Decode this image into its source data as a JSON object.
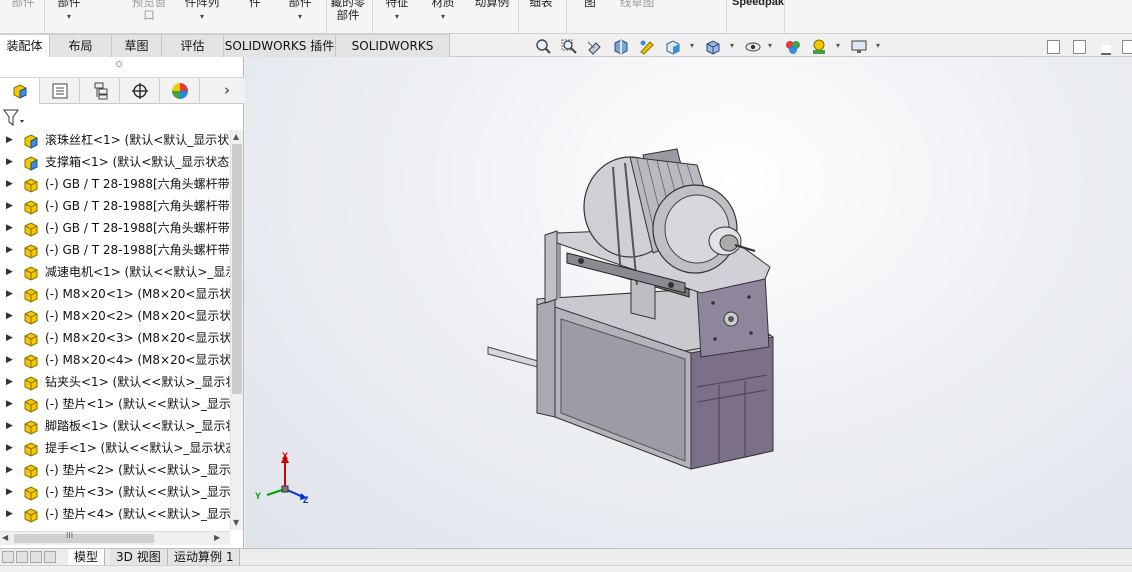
{
  "ribbon": {
    "items": [
      {
        "label": "部件",
        "dim": true
      },
      {
        "label": "部件",
        "caret": true
      },
      {
        "label": "预览窗口",
        "dim": true
      },
      {
        "label": "件阵列",
        "caret": true
      },
      {
        "label": "件"
      },
      {
        "label": "部件",
        "caret": true
      },
      {
        "label": "藏的零部件"
      },
      {
        "label": "特征",
        "caret": true
      },
      {
        "label": "材质",
        "caret": true
      },
      {
        "label": "动算例"
      },
      {
        "label": "细表"
      },
      {
        "label": "图"
      },
      {
        "label": "线草图",
        "dim": true
      },
      {
        "label": "Speedpak"
      }
    ]
  },
  "command_tabs": [
    {
      "label": "装配体",
      "active": true
    },
    {
      "label": "布局"
    },
    {
      "label": "草图"
    },
    {
      "label": "评估"
    },
    {
      "label": "SOLIDWORKS 插件"
    },
    {
      "label": "SOLIDWORKS MBD"
    }
  ],
  "heads_up_toolbar": [
    "zoom-to-fit-icon",
    "zoom-to-area-icon",
    "previous-view-icon",
    "section-view-icon",
    "dynamic-annotation-icon",
    "view-orientation-icon",
    "display-style-icon",
    "hide-show-icon",
    "edit-appearance-icon",
    "apply-scene-icon",
    "view-settings-icon"
  ],
  "panel_tabs": [
    "featuremanager-icon",
    "propertymanager-icon",
    "configurationmanager-icon",
    "dimxpertmanager-icon",
    "displaymanager-icon"
  ],
  "tree": {
    "items": [
      {
        "label": "滚珠丝杠<1> (默认<默认_显示状",
        "type": "assembly"
      },
      {
        "label": "支撑箱<1> (默认<默认_显示状态-",
        "type": "assembly"
      },
      {
        "label": "(-) GB / T 28-1988[六角头螺杆带",
        "type": "part"
      },
      {
        "label": "(-) GB / T 28-1988[六角头螺杆带",
        "type": "part"
      },
      {
        "label": "(-) GB / T 28-1988[六角头螺杆带",
        "type": "part"
      },
      {
        "label": "(-) GB / T 28-1988[六角头螺杆带",
        "type": "part"
      },
      {
        "label": "减速电机<1> (默认<<默认>_显示",
        "type": "part"
      },
      {
        "label": "(-) M8×20<1> (M8×20<显示状",
        "type": "part"
      },
      {
        "label": "(-) M8×20<2> (M8×20<显示状",
        "type": "part"
      },
      {
        "label": "(-) M8×20<3> (M8×20<显示状",
        "type": "part"
      },
      {
        "label": "(-) M8×20<4> (M8×20<显示状",
        "type": "part"
      },
      {
        "label": "钻夹头<1> (默认<<默认>_显示状",
        "type": "part"
      },
      {
        "label": "(-) 垫片<1> (默认<<默认>_显示状",
        "type": "part"
      },
      {
        "label": "脚踏板<1> (默认<<默认>_显示状",
        "type": "part"
      },
      {
        "label": "提手<1> (默认<<默认>_显示状态",
        "type": "part"
      },
      {
        "label": "(-) 垫片<2> (默认<<默认>_显示状",
        "type": "part"
      },
      {
        "label": "(-) 垫片<3> (默认<<默认>_显示状",
        "type": "part"
      },
      {
        "label": "(-) 垫片<4> (默认<<默认>_显示状",
        "type": "part"
      }
    ]
  },
  "hscroll_label": "III",
  "bottom_tabs": [
    {
      "label": "模型",
      "active": true
    },
    {
      "label": "3D 视图"
    },
    {
      "label": "运动算例 1"
    }
  ],
  "triad": {
    "x": "X",
    "y": "Y",
    "z": "Z"
  },
  "colors": {
    "accent": "#ffffff",
    "axis_x": "#d00000",
    "axis_y": "#00a000",
    "axis_z": "#0030d0",
    "part_yellow": "#f2c800",
    "assembly_blue": "#3a8ee0"
  }
}
